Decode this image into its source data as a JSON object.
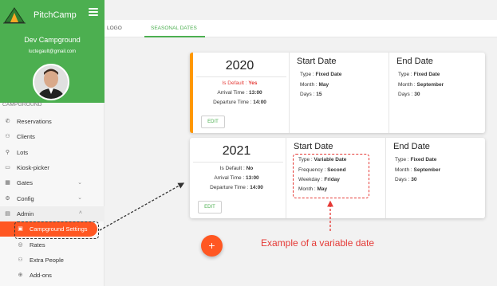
{
  "app": {
    "name": "PitchCamp"
  },
  "profile": {
    "campground": "Dev Campground",
    "email": "luctegault@gmail.com"
  },
  "sidebar": {
    "section_label": "CAMPGROUND",
    "items": [
      {
        "label": "Reservations",
        "icon": "phone-icon"
      },
      {
        "label": "Clients",
        "icon": "users-icon"
      },
      {
        "label": "Lots",
        "icon": "map-pin-icon"
      },
      {
        "label": "Kiosk-picker",
        "icon": "kiosk-icon"
      },
      {
        "label": "Gates",
        "icon": "gate-icon",
        "chevron": "down"
      },
      {
        "label": "Config",
        "icon": "gear-icon",
        "chevron": "down"
      },
      {
        "label": "Admin",
        "icon": "admin-icon",
        "chevron": "up"
      },
      {
        "label": "Campground Settings",
        "icon": "calendar-icon",
        "active": true
      },
      {
        "label": "Rates",
        "icon": "rates-icon"
      },
      {
        "label": "Extra People",
        "icon": "people-icon"
      },
      {
        "label": "Add-ons",
        "icon": "addon-icon"
      }
    ]
  },
  "tabs": [
    {
      "label": "LOGO"
    },
    {
      "label": "SEASONAL DATES",
      "active": true
    }
  ],
  "seasons": [
    {
      "year": "2020",
      "is_default_label": "Is Default :",
      "is_default_value": "Yes",
      "arrival_label": "Arrival Time :",
      "arrival_value": "13:00",
      "departure_label": "Departure Time :",
      "departure_value": "14:00",
      "edit_label": "EDIT",
      "start": {
        "title": "Start Date",
        "type_label": "Type :",
        "type_value": "Fixed Date",
        "month_label": "Month :",
        "month_value": "May",
        "days_label": "Days :",
        "days_value": "15"
      },
      "end": {
        "title": "End Date",
        "type_label": "Type :",
        "type_value": "Fixed Date",
        "month_label": "Month :",
        "month_value": "September",
        "days_label": "Days :",
        "days_value": "30"
      }
    },
    {
      "year": "2021",
      "is_default_label": "Is Default :",
      "is_default_value": "No",
      "arrival_label": "Arrival Time :",
      "arrival_value": "13:00",
      "departure_label": "Departure Time :",
      "departure_value": "14:00",
      "edit_label": "EDIT",
      "start": {
        "title": "Start Date",
        "type_label": "Type :",
        "type_value": "Variable Date",
        "frequency_label": "Frequency :",
        "frequency_value": "Second",
        "weekday_label": "Weekday :",
        "weekday_value": "Friday",
        "month_label": "Month :",
        "month_value": "May"
      },
      "end": {
        "title": "End Date",
        "type_label": "Type :",
        "type_value": "Fixed Date",
        "month_label": "Month :",
        "month_value": "September",
        "days_label": "Days :",
        "days_value": "30"
      }
    }
  ],
  "fab": {
    "label": "+"
  },
  "annotation": {
    "text": "Example of a variable date"
  },
  "colors": {
    "brand_green": "#4caf50",
    "accent_orange": "#ff5722",
    "annotation_red": "#e53935",
    "default_bar": "#ff9800"
  }
}
